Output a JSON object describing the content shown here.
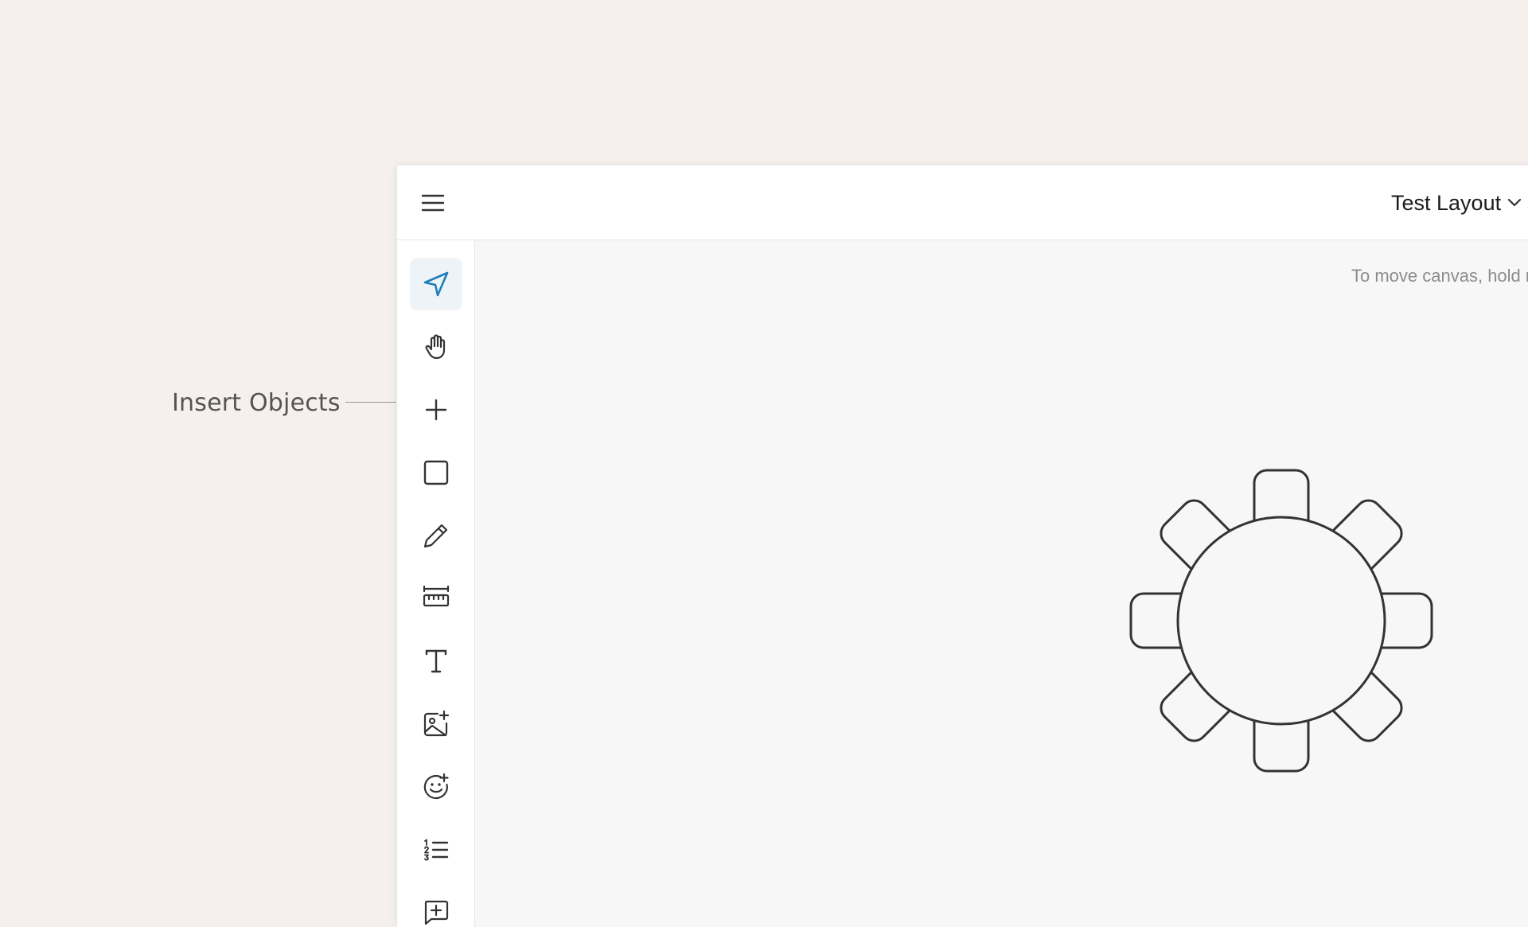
{
  "callout": {
    "label": "Insert Objects"
  },
  "header": {
    "layout_name": "Test Layout",
    "menu_icon": "hamburger-menu-icon",
    "dropdown_icon": "chevron-down-icon"
  },
  "toolbar": {
    "tools": [
      {
        "name": "select-tool",
        "icon": "navigation-arrow-icon",
        "active": true
      },
      {
        "name": "pan-tool",
        "icon": "hand-icon",
        "active": false
      },
      {
        "name": "insert-objects-tool",
        "icon": "plus-icon",
        "active": false
      },
      {
        "name": "rectangle-tool",
        "icon": "square-icon",
        "active": false
      },
      {
        "name": "draw-tool",
        "icon": "pencil-icon",
        "active": false
      },
      {
        "name": "measure-tool",
        "icon": "ruler-icon",
        "active": false
      },
      {
        "name": "text-tool",
        "icon": "text-icon",
        "active": false
      },
      {
        "name": "image-tool",
        "icon": "image-plus-icon",
        "active": false
      },
      {
        "name": "emoji-tool",
        "icon": "smiley-plus-icon",
        "active": false
      },
      {
        "name": "list-tool",
        "icon": "numbered-list-icon",
        "active": false
      },
      {
        "name": "comment-tool",
        "icon": "message-plus-icon",
        "active": false
      }
    ]
  },
  "canvas": {
    "hint": "To move canvas, hold mouse w",
    "objects": [
      {
        "type": "round-table",
        "seats": 8
      }
    ]
  },
  "colors": {
    "background": "#f5f0ed",
    "accent": "#1f7fb8",
    "active_tool_bg": "#eef3f7",
    "canvas": "#f7f7f7",
    "icon": "#333333"
  }
}
